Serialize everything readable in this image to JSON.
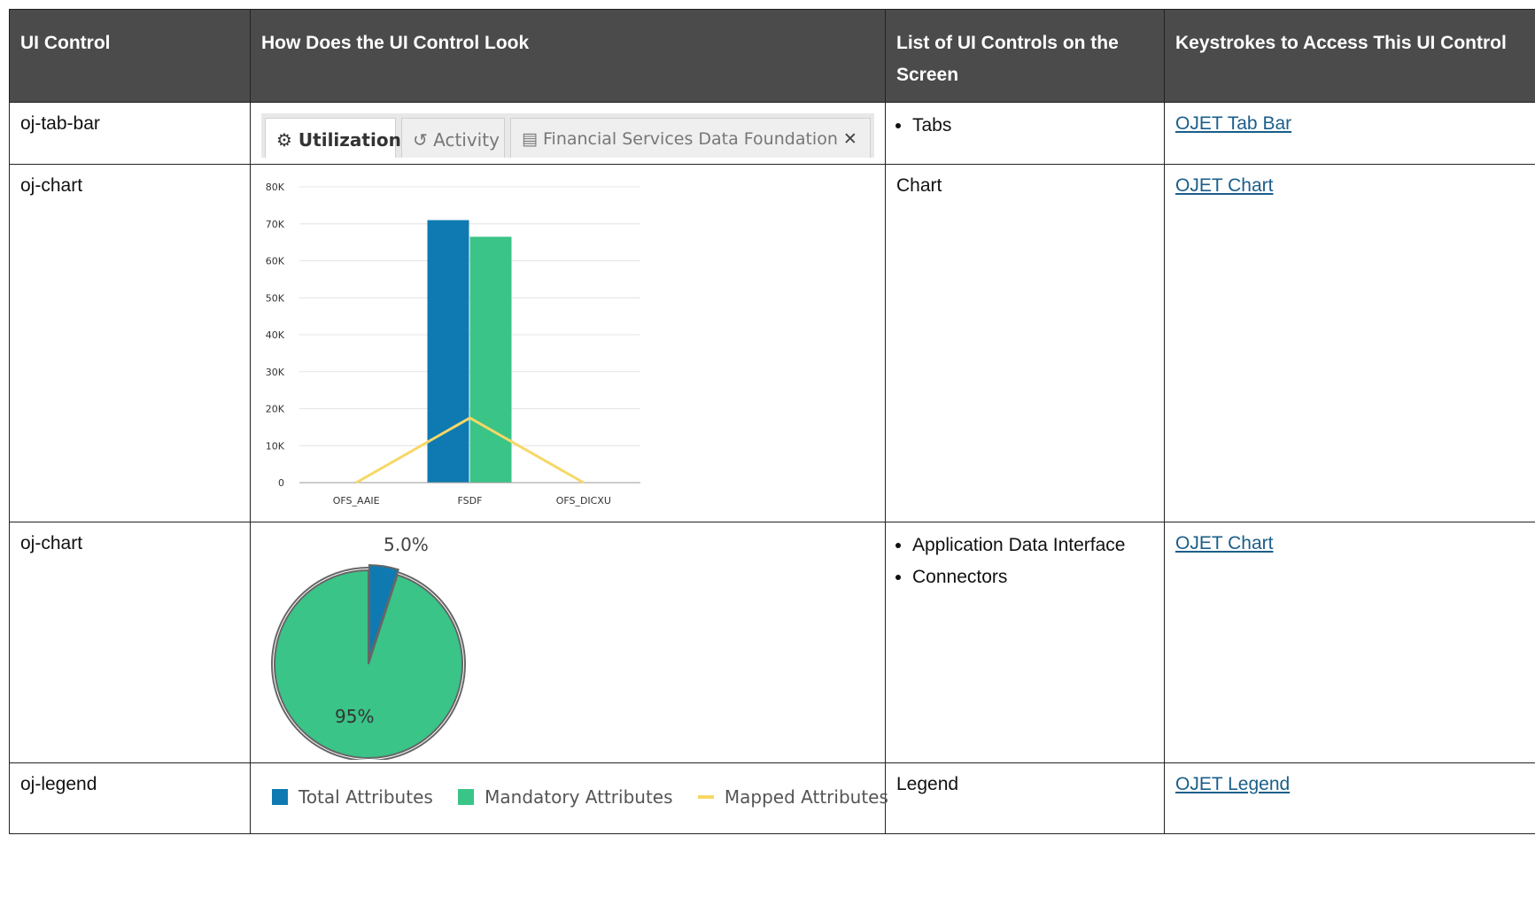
{
  "headers": [
    "UI Control",
    "How Does the UI Control Look",
    "List of UI Controls on the Screen",
    "Keystrokes to Access This UI Control"
  ],
  "rows": [
    {
      "control": "oj-tab-bar",
      "list": [
        "Tabs"
      ],
      "link": "OJET Tab Bar"
    },
    {
      "control": "oj-chart",
      "list_text": "Chart",
      "link": "OJET Chart"
    },
    {
      "control": "oj-chart",
      "list": [
        "Application Data Interface",
        "Connectors"
      ],
      "link": "OJET Chart"
    },
    {
      "control": "oj-legend",
      "list_text": "Legend",
      "link": "OJET Legend"
    }
  ],
  "tabs": {
    "utilization": "Utilization",
    "activity": "Activity",
    "financial": "Financial Services Data Foundation",
    "icons": [
      "gear-icon",
      "history-icon",
      "document-icon",
      "close-icon"
    ]
  },
  "chart_data": [
    {
      "type": "bar",
      "categories": [
        "OFS_AAIE",
        "FSDF",
        "OFS_DICXU"
      ],
      "yticks": [
        "0",
        "10K",
        "20K",
        "30K",
        "40K",
        "50K",
        "60K",
        "70K",
        "80K"
      ],
      "ylim": [
        0,
        80000
      ],
      "series": [
        {
          "values": [
            0,
            71000,
            0
          ],
          "color": "#0f7ab1",
          "kind": "bar"
        },
        {
          "values": [
            0,
            66500,
            0
          ],
          "color": "#3ac488",
          "kind": "bar"
        },
        {
          "values": [
            0,
            17500,
            0
          ],
          "color": "#f7d766",
          "kind": "line"
        }
      ]
    },
    {
      "type": "pie",
      "slices": [
        {
          "label": "5.0%",
          "value": 5,
          "color": "#0f7ab1"
        },
        {
          "label": "95%",
          "value": 95,
          "color": "#3ac488"
        }
      ]
    }
  ],
  "legend": {
    "items": [
      {
        "label": "Total Attributes",
        "color": "#0f7ab1",
        "kind": "box"
      },
      {
        "label": "Mandatory Attributes",
        "color": "#3ac488",
        "kind": "box"
      },
      {
        "label": "Mapped Attributes",
        "color": "#f7d766",
        "kind": "line"
      }
    ]
  }
}
